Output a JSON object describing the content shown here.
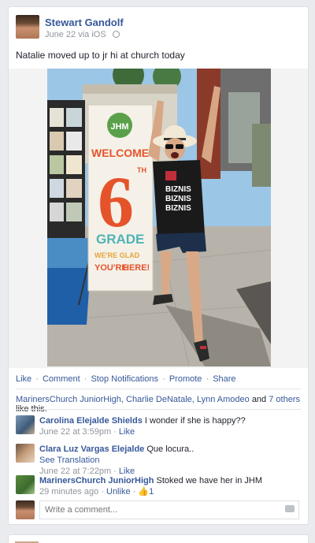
{
  "post": {
    "author": "Stewart Gandolf",
    "date": "June 22 via iOS",
    "text": "Natalie moved up to jr hi at church today"
  },
  "photo_sign": {
    "badge": "JHM",
    "welcome": "WELCOME",
    "number": "6",
    "ordinal": "TH",
    "grade": "GRADE",
    "were_glad": "WE'RE GLAD",
    "your": "YOU'RE",
    "here": "HERE!",
    "shirt_line1": "BIZNIS",
    "shirt_line2": "BIZNIS",
    "shirt_line3": "BIZNIS"
  },
  "actions": {
    "like": "Like",
    "comment": "Comment",
    "stop": "Stop Notifications",
    "promote": "Promote",
    "share": "Share"
  },
  "likes": {
    "names": "MarinersChurch JuniorHigh, Charlie DeNatale, Lynn Amodeo",
    "and": "and",
    "others": "7 others",
    "suffix": "like this."
  },
  "comments": [
    {
      "name": "Carolina Elejalde Shields",
      "text": "I wonder if she is happy??",
      "time": "June 22 at 3:59pm",
      "like": "Like"
    },
    {
      "name": "Clara Luz Vargas Elejalde",
      "text": "Que locura..",
      "translate": "See Translation",
      "time": "June 22 at 7:22pm",
      "like": "Like"
    },
    {
      "name": "MarinersChurch JuniorHigh",
      "text": "Stoked we have her in JHM",
      "time": "29 minutes ago",
      "unlike": "Unlike",
      "like_count": "1"
    }
  ],
  "write": {
    "placeholder": "Write a comment..."
  },
  "colors": {
    "link": "#365899",
    "meta": "#90949c",
    "accent_orange": "#e5532b",
    "accent_teal": "#4fb3b5"
  }
}
